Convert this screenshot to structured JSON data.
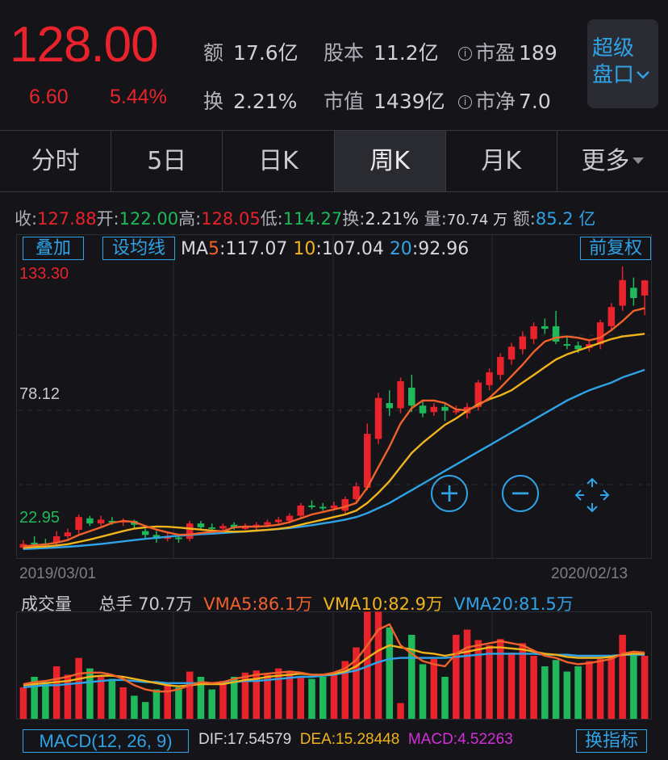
{
  "quote": {
    "price": "128.00",
    "change": "6.60",
    "change_pct": "5.44%",
    "stats": [
      {
        "label": "额",
        "value": "17.6亿"
      },
      {
        "label": "股本",
        "value": "11.2亿"
      },
      {
        "label": "市盈",
        "value": "189"
      },
      {
        "label": "换",
        "value": "2.21%"
      },
      {
        "label": "市值",
        "value": "1439亿"
      },
      {
        "label": "市净",
        "value": "7.0"
      }
    ],
    "super_button": {
      "line1": "超级",
      "line2": "盘口"
    }
  },
  "tabs": [
    {
      "label": "分时"
    },
    {
      "label": "5日"
    },
    {
      "label": "日K"
    },
    {
      "label": "周K"
    },
    {
      "label": "月K"
    },
    {
      "label": "更多"
    }
  ],
  "active_tab": "周K",
  "summary": {
    "close_label": "收:",
    "close": "127.88",
    "open_label": "开:",
    "open": "122.00",
    "high_label": "高:",
    "high": "128.05",
    "low_label": "低:",
    "low": "114.27",
    "turnover_label": "换:",
    "turnover": "2.21%",
    "volume_label": "量:",
    "volume": "70.74 万",
    "amount_label": "额:",
    "amount": "85.2 亿"
  },
  "buttons": {
    "overlay": "叠加",
    "set_ma": "设均线",
    "adjust": "前复权",
    "switch_indicator": "换指标"
  },
  "ma_legend": {
    "prefix": "MA",
    "ma5_key": "5",
    "ma5": ":117.07",
    "ma10_key": "10",
    "ma10": ":107.04",
    "ma20_key": "20",
    "ma20": ":92.96"
  },
  "price_axis": {
    "max": "133.30",
    "mid": "78.12",
    "min": "22.95"
  },
  "date_axis": {
    "start": "2019/03/01",
    "end": "2020/02/13"
  },
  "volume_legend": {
    "title": "成交量",
    "total_label": "总手",
    "total": "70.7万",
    "vma5": "VMA5:86.1万",
    "vma10": "VMA10:82.9万",
    "vma20": "VMA20:81.5万"
  },
  "macd": {
    "label": "MACD(12, 26, 9)",
    "dif": "DIF:17.54579",
    "dea": "DEA:15.28448",
    "macd": "MACD:4.52263"
  },
  "colors": {
    "up": "#e8232b",
    "down": "#1fb85a",
    "ma5": "#f0612b",
    "ma10": "#f0b31b",
    "ma20": "#2fa3e6",
    "accent": "#2fa3e6"
  },
  "icons": {
    "zoom_in": "plus-circle-icon",
    "zoom_out": "minus-circle-icon",
    "move": "four-arrows-move-icon",
    "info": "info-circle-icon",
    "more": "caret-down-icon",
    "super": "chevron-down-icon"
  },
  "chart_data": {
    "type": "candlestick",
    "ylim": [
      22.95,
      133.3
    ],
    "x_start": "2019/03/01",
    "x_end": "2020/02/13",
    "candles": [
      {
        "o": 23.5,
        "c": 25.0,
        "h": 26.5,
        "l": 22.9
      },
      {
        "o": 25.5,
        "c": 25.0,
        "h": 28.0,
        "l": 24.0
      },
      {
        "o": 25.2,
        "c": 25.0,
        "h": 27.0,
        "l": 23.5
      },
      {
        "o": 25.5,
        "c": 28.0,
        "h": 30.0,
        "l": 24.5
      },
      {
        "o": 28.0,
        "c": 29.5,
        "h": 31.0,
        "l": 27.0
      },
      {
        "o": 30.5,
        "c": 35.5,
        "h": 36.5,
        "l": 29.0
      },
      {
        "o": 35.0,
        "c": 33.0,
        "h": 36.0,
        "l": 32.0
      },
      {
        "o": 33.0,
        "c": 34.5,
        "h": 36.0,
        "l": 31.5
      },
      {
        "o": 34.0,
        "c": 33.8,
        "h": 35.5,
        "l": 32.5
      },
      {
        "o": 33.5,
        "c": 34.0,
        "h": 35.0,
        "l": 32.0
      },
      {
        "o": 34.0,
        "c": 32.5,
        "h": 34.5,
        "l": 31.0
      },
      {
        "o": 30.0,
        "c": 28.5,
        "h": 31.0,
        "l": 27.0
      },
      {
        "o": 28.5,
        "c": 27.0,
        "h": 30.0,
        "l": 25.5
      },
      {
        "o": 27.0,
        "c": 28.0,
        "h": 29.5,
        "l": 26.0
      },
      {
        "o": 27.5,
        "c": 27.0,
        "h": 28.5,
        "l": 25.5
      },
      {
        "o": 27.0,
        "c": 33.0,
        "h": 34.0,
        "l": 26.0
      },
      {
        "o": 33.0,
        "c": 31.5,
        "h": 34.0,
        "l": 30.5
      },
      {
        "o": 31.5,
        "c": 31.0,
        "h": 33.0,
        "l": 30.0
      },
      {
        "o": 31.0,
        "c": 32.0,
        "h": 33.0,
        "l": 30.0
      },
      {
        "o": 32.5,
        "c": 31.5,
        "h": 33.5,
        "l": 30.5
      },
      {
        "o": 31.5,
        "c": 31.5,
        "h": 33.0,
        "l": 30.5
      },
      {
        "o": 31.5,
        "c": 32.5,
        "h": 33.5,
        "l": 30.5
      },
      {
        "o": 32.5,
        "c": 33.5,
        "h": 34.5,
        "l": 31.5
      },
      {
        "o": 33.5,
        "c": 34.5,
        "h": 35.5,
        "l": 32.5
      },
      {
        "o": 34.0,
        "c": 36.0,
        "h": 37.0,
        "l": 33.0
      },
      {
        "o": 36.0,
        "c": 40.0,
        "h": 41.0,
        "l": 35.0
      },
      {
        "o": 40.0,
        "c": 39.5,
        "h": 42.0,
        "l": 38.5
      },
      {
        "o": 39.5,
        "c": 39.0,
        "h": 41.0,
        "l": 38.0
      },
      {
        "o": 39.0,
        "c": 40.0,
        "h": 41.5,
        "l": 38.0
      },
      {
        "o": 38.0,
        "c": 42.5,
        "h": 43.5,
        "l": 37.0
      },
      {
        "o": 42.5,
        "c": 47.5,
        "h": 49.0,
        "l": 41.5
      },
      {
        "o": 47.0,
        "c": 68.0,
        "h": 72.0,
        "l": 46.0
      },
      {
        "o": 66.0,
        "c": 82.0,
        "h": 84.0,
        "l": 64.0
      },
      {
        "o": 80.0,
        "c": 78.0,
        "h": 85.0,
        "l": 75.0
      },
      {
        "o": 78.0,
        "c": 88.5,
        "h": 90.0,
        "l": 76.0
      },
      {
        "o": 86.0,
        "c": 79.0,
        "h": 91.0,
        "l": 76.5
      },
      {
        "o": 79.0,
        "c": 76.0,
        "h": 80.5,
        "l": 74.5
      },
      {
        "o": 76.5,
        "c": 78.5,
        "h": 80.0,
        "l": 75.0
      },
      {
        "o": 78.5,
        "c": 77.0,
        "h": 80.0,
        "l": 73.0
      },
      {
        "o": 77.0,
        "c": 77.0,
        "h": 79.0,
        "l": 75.5
      },
      {
        "o": 76.0,
        "c": 78.5,
        "h": 80.0,
        "l": 74.0
      },
      {
        "o": 78.5,
        "c": 88.0,
        "h": 89.0,
        "l": 77.0
      },
      {
        "o": 87.0,
        "c": 92.0,
        "h": 93.5,
        "l": 85.0
      },
      {
        "o": 91.0,
        "c": 98.0,
        "h": 99.5,
        "l": 89.0
      },
      {
        "o": 97.0,
        "c": 102.0,
        "h": 103.5,
        "l": 95.0
      },
      {
        "o": 101.0,
        "c": 106.0,
        "h": 108.0,
        "l": 99.0
      },
      {
        "o": 105.0,
        "c": 110.0,
        "h": 111.5,
        "l": 103.0
      },
      {
        "o": 110.0,
        "c": 109.0,
        "h": 113.0,
        "l": 107.0
      },
      {
        "o": 110.0,
        "c": 104.0,
        "h": 116.0,
        "l": 103.0
      },
      {
        "o": 103.0,
        "c": 102.5,
        "h": 106.0,
        "l": 101.0
      },
      {
        "o": 102.5,
        "c": 101.0,
        "h": 104.0,
        "l": 99.5
      },
      {
        "o": 101.5,
        "c": 103.0,
        "h": 105.0,
        "l": 100.0
      },
      {
        "o": 103.0,
        "c": 111.5,
        "h": 112.5,
        "l": 101.0
      },
      {
        "o": 110.0,
        "c": 117.5,
        "h": 119.0,
        "l": 108.0
      },
      {
        "o": 118.0,
        "c": 128.0,
        "h": 133.3,
        "l": 116.0
      },
      {
        "o": 125.0,
        "c": 121.0,
        "h": 129.0,
        "l": 118.0
      },
      {
        "o": 122.0,
        "c": 127.88,
        "h": 128.05,
        "l": 114.27
      }
    ],
    "ma5": [
      24.0,
      24.5,
      24.8,
      25.5,
      26.5,
      28.5,
      30.0,
      31.5,
      33.2,
      34.0,
      33.6,
      32.0,
      30.6,
      29.5,
      28.6,
      28.7,
      29.3,
      29.7,
      30.0,
      31.5,
      31.8,
      31.7,
      32.0,
      32.5,
      33.5,
      35.0,
      36.5,
      37.5,
      38.5,
      39.5,
      41.0,
      47.0,
      55.0,
      63.0,
      72.0,
      78.0,
      81.0,
      81.0,
      80.0,
      77.5,
      77.2,
      79.0,
      82.0,
      86.0,
      90.5,
      95.0,
      100.0,
      104.0,
      105.5,
      106.0,
      105.5,
      104.5,
      105.5,
      108.5,
      112.0,
      116.0,
      117.07
    ],
    "ma10": [
      23.5,
      23.8,
      24.0,
      24.4,
      24.9,
      25.8,
      26.7,
      27.8,
      28.9,
      30.0,
      31.0,
      31.5,
      31.8,
      31.7,
      31.4,
      31.0,
      30.6,
      30.2,
      29.9,
      29.8,
      29.9,
      30.2,
      30.5,
      30.9,
      31.5,
      32.5,
      33.5,
      34.5,
      35.5,
      36.5,
      38.0,
      41.0,
      45.0,
      49.5,
      55.0,
      60.5,
      64.5,
      68.0,
      71.5,
      74.0,
      77.0,
      79.5,
      81.5,
      83.0,
      85.0,
      88.0,
      91.0,
      94.0,
      97.0,
      99.0,
      100.5,
      102.0,
      103.5,
      105.0,
      106.0,
      106.5,
      107.04
    ],
    "ma20": [
      23.0,
      23.2,
      23.4,
      23.6,
      23.9,
      24.2,
      24.6,
      25.0,
      25.5,
      26.0,
      26.5,
      27.0,
      27.4,
      27.8,
      28.2,
      28.5,
      28.8,
      29.0,
      29.3,
      29.6,
      29.9,
      30.2,
      30.5,
      30.8,
      31.2,
      31.7,
      32.3,
      33.0,
      33.7,
      34.5,
      35.5,
      37.0,
      39.0,
      41.0,
      43.5,
      46.0,
      48.5,
      51.0,
      53.5,
      56.0,
      58.5,
      61.0,
      63.5,
      66.0,
      68.5,
      71.0,
      73.5,
      76.0,
      78.5,
      81.0,
      83.0,
      85.0,
      86.5,
      88.0,
      90.0,
      91.5,
      92.96
    ],
    "volume": [
      0.3,
      0.4,
      0.35,
      0.5,
      0.42,
      0.58,
      0.48,
      0.4,
      0.38,
      0.3,
      0.22,
      0.16,
      0.28,
      0.34,
      0.3,
      0.45,
      0.4,
      0.28,
      0.36,
      0.4,
      0.44,
      0.46,
      0.42,
      0.48,
      0.45,
      0.4,
      0.38,
      0.4,
      0.42,
      0.55,
      0.68,
      1.02,
      1.02,
      0.87,
      0.15,
      0.8,
      0.52,
      0.57,
      0.4,
      0.8,
      0.85,
      0.75,
      0.7,
      0.76,
      0.63,
      0.72,
      0.6,
      0.5,
      0.56,
      0.45,
      0.5,
      0.55,
      0.57,
      0.58,
      0.8,
      0.62,
      0.6
    ],
    "vma5": [
      0.33,
      0.35,
      0.36,
      0.38,
      0.4,
      0.43,
      0.44,
      0.44,
      0.42,
      0.38,
      0.32,
      0.28,
      0.26,
      0.26,
      0.28,
      0.32,
      0.35,
      0.34,
      0.35,
      0.38,
      0.4,
      0.42,
      0.43,
      0.44,
      0.45,
      0.44,
      0.42,
      0.42,
      0.44,
      0.48,
      0.56,
      0.7,
      0.85,
      0.9,
      0.7,
      0.62,
      0.55,
      0.52,
      0.5,
      0.62,
      0.68,
      0.7,
      0.72,
      0.74,
      0.72,
      0.7,
      0.65,
      0.6,
      0.58,
      0.54,
      0.52,
      0.53,
      0.55,
      0.57,
      0.62,
      0.64,
      0.63
    ],
    "vma10": [
      0.32,
      0.33,
      0.34,
      0.35,
      0.36,
      0.38,
      0.4,
      0.41,
      0.41,
      0.4,
      0.38,
      0.36,
      0.34,
      0.32,
      0.31,
      0.32,
      0.33,
      0.33,
      0.33,
      0.35,
      0.37,
      0.38,
      0.4,
      0.41,
      0.42,
      0.43,
      0.42,
      0.42,
      0.43,
      0.45,
      0.5,
      0.58,
      0.65,
      0.7,
      0.68,
      0.66,
      0.63,
      0.62,
      0.6,
      0.62,
      0.64,
      0.66,
      0.68,
      0.68,
      0.67,
      0.66,
      0.64,
      0.62,
      0.61,
      0.59,
      0.58,
      0.58,
      0.58,
      0.59,
      0.61,
      0.62,
      0.62
    ],
    "vma20": [
      0.3,
      0.31,
      0.32,
      0.32,
      0.33,
      0.34,
      0.35,
      0.36,
      0.37,
      0.37,
      0.36,
      0.35,
      0.35,
      0.34,
      0.34,
      0.34,
      0.34,
      0.34,
      0.34,
      0.35,
      0.36,
      0.36,
      0.37,
      0.38,
      0.39,
      0.4,
      0.4,
      0.41,
      0.42,
      0.44,
      0.46,
      0.5,
      0.54,
      0.57,
      0.58,
      0.58,
      0.58,
      0.58,
      0.58,
      0.59,
      0.6,
      0.61,
      0.62,
      0.62,
      0.62,
      0.62,
      0.62,
      0.61,
      0.61,
      0.61,
      0.6,
      0.6,
      0.6,
      0.6,
      0.61,
      0.61,
      0.61
    ]
  }
}
